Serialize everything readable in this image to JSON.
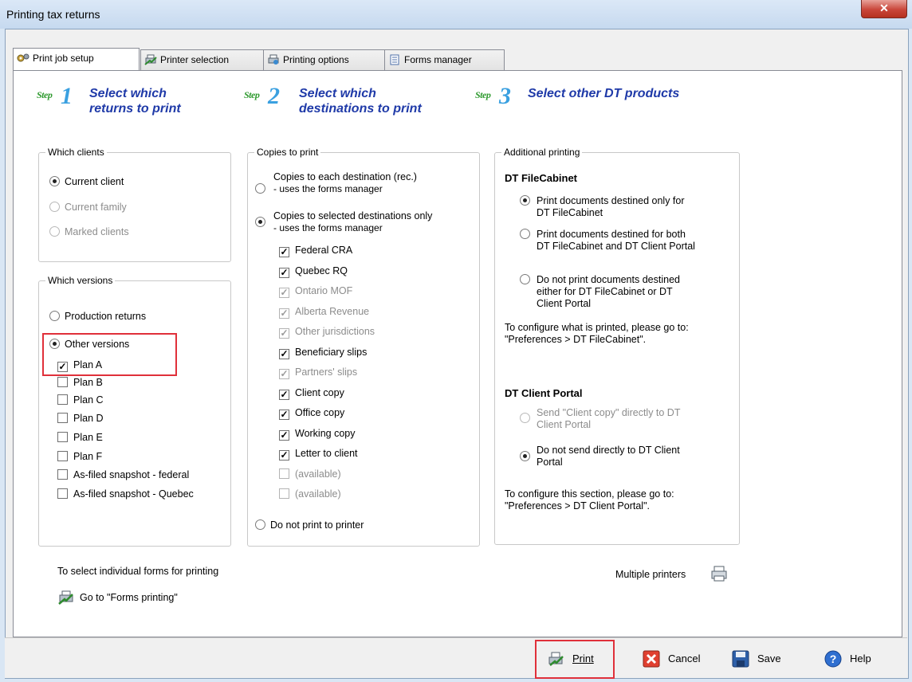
{
  "window": {
    "title": "Printing tax returns",
    "close_label": "✕"
  },
  "tabs": [
    {
      "label": "Print job setup",
      "icon": "gears-icon"
    },
    {
      "label": "Printer selection",
      "icon": "printer-icon"
    },
    {
      "label": "Printing options",
      "icon": "printer-options-icon"
    },
    {
      "label": "Forms manager",
      "icon": "forms-icon"
    }
  ],
  "steps": [
    {
      "logo_text": "Step",
      "number": "1",
      "title_line1": "Select which",
      "title_line2": "returns to print"
    },
    {
      "logo_text": "Step",
      "number": "2",
      "title_line1": "Select which",
      "title_line2": "destinations to print"
    },
    {
      "logo_text": "Step",
      "number": "3",
      "title_line1": "Select other DT products",
      "title_line2": ""
    }
  ],
  "which_clients": {
    "legend": "Which clients",
    "options": [
      {
        "label": "Current client",
        "selected": true,
        "enabled": true
      },
      {
        "label": "Current family",
        "selected": false,
        "enabled": false
      },
      {
        "label": "Marked clients",
        "selected": false,
        "enabled": false
      }
    ]
  },
  "which_versions": {
    "legend": "Which versions",
    "options": [
      {
        "label": "Production returns",
        "selected": false
      },
      {
        "label": "Other versions",
        "selected": true
      }
    ],
    "plans": [
      {
        "label": "Plan A",
        "checked": true
      },
      {
        "label": "Plan B",
        "checked": false
      },
      {
        "label": "Plan C",
        "checked": false
      },
      {
        "label": "Plan D",
        "checked": false
      },
      {
        "label": "Plan E",
        "checked": false
      },
      {
        "label": "Plan F",
        "checked": false
      },
      {
        "label": "As-filed snapshot - federal",
        "checked": false
      },
      {
        "label": "As-filed snapshot - Quebec",
        "checked": false
      }
    ]
  },
  "copies_to_print": {
    "legend": "Copies to print",
    "option1_line1": "Copies to each destination (rec.)",
    "option1_line2": "- uses the forms manager",
    "option2_line1": "Copies to selected destinations only",
    "option2_line2": "- uses the forms manager",
    "destinations": [
      {
        "label": "Federal CRA",
        "checked": true,
        "enabled": true
      },
      {
        "label": "Quebec RQ",
        "checked": true,
        "enabled": true
      },
      {
        "label": "Ontario MOF",
        "checked": true,
        "enabled": false
      },
      {
        "label": "Alberta Revenue",
        "checked": true,
        "enabled": false
      },
      {
        "label": "Other jurisdictions",
        "checked": true,
        "enabled": false
      },
      {
        "label": "Beneficiary slips",
        "checked": true,
        "enabled": true
      },
      {
        "label": "Partners' slips",
        "checked": true,
        "enabled": false
      },
      {
        "label": "Client copy",
        "checked": true,
        "enabled": true
      },
      {
        "label": "Office copy",
        "checked": true,
        "enabled": true
      },
      {
        "label": "Working copy",
        "checked": true,
        "enabled": true
      },
      {
        "label": "Letter to client",
        "checked": true,
        "enabled": true
      },
      {
        "label": "(available)",
        "checked": false,
        "enabled": false
      },
      {
        "label": "(available)",
        "checked": false,
        "enabled": false
      }
    ],
    "option3": "Do not print to printer"
  },
  "additional_printing": {
    "legend": "Additional printing",
    "filecabinet_title": "DT FileCabinet",
    "fc_opt1_line1": "Print documents destined only for",
    "fc_opt1_line2": "DT FileCabinet",
    "fc_opt2_line1": "Print documents destined for both",
    "fc_opt2_line2": "DT FileCabinet and DT Client Portal",
    "fc_opt3_line1": "Do not print documents destined",
    "fc_opt3_line2": "either for DT FileCabinet or DT",
    "fc_opt3_line3": "Client Portal",
    "fc_note_line1": "To configure what is printed, please go to:",
    "fc_note_line2": "\"Preferences > DT FileCabinet\".",
    "portal_title": "DT Client Portal",
    "cp_opt1_line1": "Send \"Client copy\" directly to DT",
    "cp_opt1_line2": "Client Portal",
    "cp_opt2_line1": "Do not send directly to DT Client",
    "cp_opt2_line2": "Portal",
    "cp_note_line1": "To configure this section, please go to:",
    "cp_note_line2": "\"Preferences > DT Client Portal\"."
  },
  "footer": {
    "individual_forms_label": "To select individual forms for printing",
    "forms_printing_link": "Go to \"Forms printing\"",
    "multiple_printers_label": "Multiple printers"
  },
  "buttons": {
    "print": "Print",
    "cancel": "Cancel",
    "save": "Save",
    "help": "Help"
  }
}
